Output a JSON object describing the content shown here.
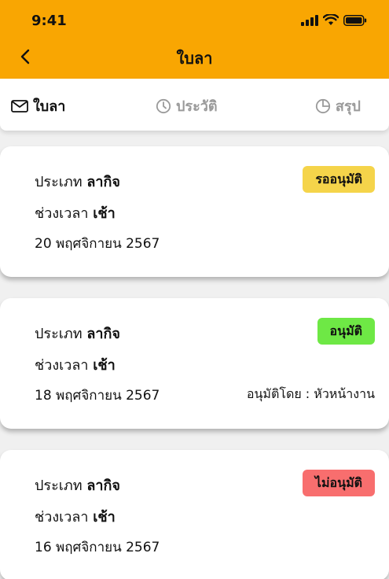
{
  "status_bar": {
    "time": "9:41"
  },
  "header": {
    "title": "ใบลา"
  },
  "tabs": [
    {
      "label": "ใบลา",
      "icon": "mail-icon",
      "active": true
    },
    {
      "label": "ประวัติ",
      "icon": "clock-icon",
      "active": false
    },
    {
      "label": "สรุป",
      "icon": "pie-chart-icon",
      "active": false
    }
  ],
  "colors": {
    "header_bg": "#f9a602",
    "pending": "#f5d44a",
    "approved": "#6ee845",
    "rejected": "#f86e6e"
  },
  "requests": [
    {
      "type_label": "ประเภท",
      "type_value": "ลากิจ",
      "period_label": "ช่วงเวลา",
      "period_value": "เช้า",
      "date": "20 พฤศจิกายน 2567",
      "status": "รออนุมัติ",
      "approver": ""
    },
    {
      "type_label": "ประเภท",
      "type_value": "ลากิจ",
      "period_label": "ช่วงเวลา",
      "period_value": "เช้า",
      "date": "18 พฤศจิกายน 2567",
      "status": "อนุมัติ",
      "approver": "อนุมัติโดย : หัวหน้างาน"
    },
    {
      "type_label": "ประเภท",
      "type_value": "ลากิจ",
      "period_label": "ช่วงเวลา",
      "period_value": "เช้า",
      "date": "16 พฤศจิกายน 2567",
      "status": "ไม่อนุมัติ",
      "approver": ""
    }
  ]
}
